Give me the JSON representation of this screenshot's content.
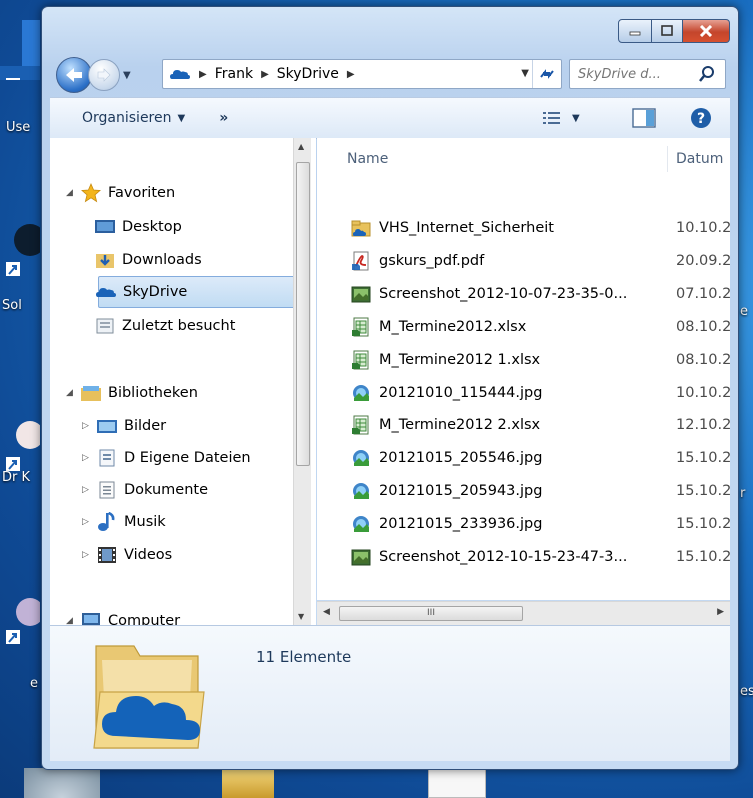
{
  "desktop": {
    "left_labels": [
      "Use",
      "Sol",
      "Dr K",
      "e"
    ],
    "right_labels": [
      "e",
      "r",
      "es"
    ]
  },
  "window": {
    "address": {
      "crumbs": [
        "Frank",
        "SkyDrive"
      ],
      "search_placeholder": "SkyDrive d..."
    },
    "toolbar": {
      "organize": "Organisieren",
      "more": "»"
    },
    "navigation": {
      "favorites": {
        "label": "Favoriten",
        "items": [
          "Desktop",
          "Downloads",
          "SkyDrive",
          "Zuletzt besucht"
        ]
      },
      "libraries": {
        "label": "Bibliotheken",
        "items": [
          "Bilder",
          "D Eigene Dateien",
          "Dokumente",
          "Musik",
          "Videos"
        ]
      },
      "computer": {
        "label": "Computer"
      }
    },
    "columns": {
      "name": "Name",
      "date": "Datum"
    },
    "files": [
      {
        "name": "VHS_Internet_Sicherheit",
        "date": "10.10.2",
        "type": "folder"
      },
      {
        "name": "gskurs_pdf.pdf",
        "date": "20.09.2",
        "type": "pdf"
      },
      {
        "name": "Screenshot_2012-10-07-23-35-0...",
        "date": "07.10.2",
        "type": "image"
      },
      {
        "name": "M_Termine2012.xlsx",
        "date": "08.10.2",
        "type": "excel"
      },
      {
        "name": "M_Termine2012 1.xlsx",
        "date": "08.10.2",
        "type": "excel"
      },
      {
        "name": "20121010_115444.jpg",
        "date": "10.10.2",
        "type": "photo"
      },
      {
        "name": "M_Termine2012 2.xlsx",
        "date": "12.10.2",
        "type": "excel"
      },
      {
        "name": "20121015_205546.jpg",
        "date": "15.10.2",
        "type": "photo"
      },
      {
        "name": "20121015_205943.jpg",
        "date": "15.10.2",
        "type": "photo"
      },
      {
        "name": "20121015_233936.jpg",
        "date": "15.10.2",
        "type": "photo"
      },
      {
        "name": "Screenshot_2012-10-15-23-47-3...",
        "date": "15.10.2",
        "type": "image"
      }
    ],
    "details": {
      "count_text": "11 Elemente"
    },
    "scroll_thumb_glyph": "III"
  }
}
